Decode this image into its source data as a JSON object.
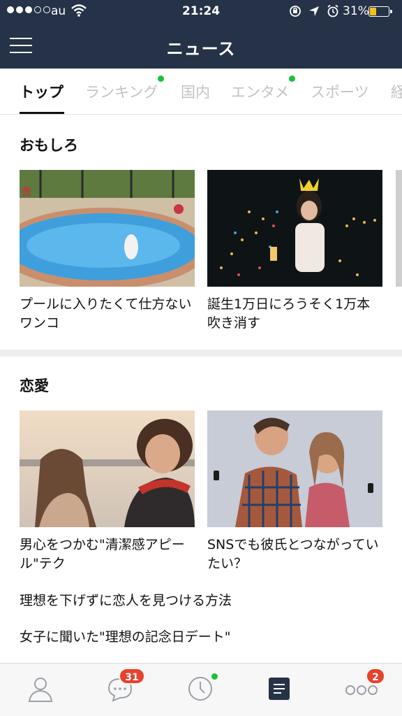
{
  "status_bar": {
    "carrier": "au",
    "time": "21:24",
    "battery_percent": "31%",
    "battery_level": 0.31,
    "signal_bars_filled": 3,
    "signal_bars_total": 5,
    "icons": [
      "wifi-icon",
      "rotation-lock-icon",
      "location-arrow-icon",
      "alarm-icon",
      "battery-icon"
    ]
  },
  "header": {
    "title": "ニュース",
    "menu_icon": "hamburger-menu-icon",
    "background": "#253247"
  },
  "tabs": [
    {
      "label": "トップ",
      "active": true,
      "new_dot": false
    },
    {
      "label": "ランキング",
      "active": false,
      "new_dot": true
    },
    {
      "label": "国内",
      "active": false,
      "new_dot": false
    },
    {
      "label": "エンタメ",
      "active": false,
      "new_dot": true
    },
    {
      "label": "スポーツ",
      "active": false,
      "new_dot": false
    },
    {
      "label": "経",
      "active": false,
      "new_dot": false
    }
  ],
  "sections": [
    {
      "title": "おもしろ",
      "cards": [
        {
          "title": "プールに入りたくて仕方ないワンコ",
          "image": "dog-pool-photo"
        },
        {
          "title": "誕生1万日にろうそく1万本吹き消す",
          "image": "candles-crown-photo"
        }
      ]
    },
    {
      "title": "恋愛",
      "cards": [
        {
          "title": "男心をつかむ\"清潔感アピール\"テク",
          "image": "couple-sunset-photo"
        },
        {
          "title": "SNSでも彼氏とつながっていたい？",
          "image": "couple-phones-photo"
        }
      ],
      "links": [
        "理想を下げずに恋人を見つける方法",
        "女子に聞いた\"理想の記念日デート\""
      ]
    }
  ],
  "bottom_bar": {
    "items": [
      {
        "name": "friends-tab",
        "icon": "person-icon"
      },
      {
        "name": "chats-tab",
        "icon": "chat-bubble-icon",
        "badge": "31"
      },
      {
        "name": "timeline-tab",
        "icon": "clock-icon",
        "new_dot": true
      },
      {
        "name": "news-tab",
        "icon": "news-icon",
        "active": true
      },
      {
        "name": "more-tab",
        "icon": "more-dots-icon",
        "badge": "2"
      }
    ]
  },
  "colors": {
    "accent_green": "#1bc03c",
    "badge_red": "#e8412c",
    "active_tab_text": "#111111",
    "inactive_tab_text": "#c3c3c3"
  }
}
